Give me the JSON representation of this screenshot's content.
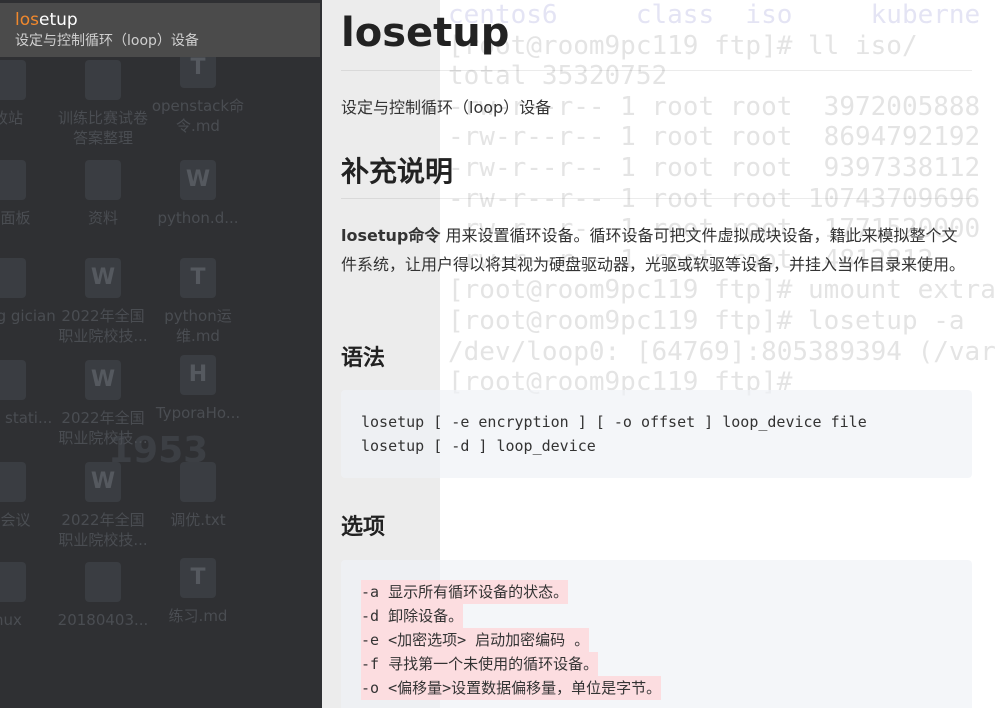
{
  "search_result": {
    "match": "los",
    "rest": "etup",
    "description": "设定与控制循环（loop）设备"
  },
  "desktop": {
    "icons": [
      "收站",
      "训练比赛试卷答案整理",
      "openstack命令.md",
      "制面板",
      "资料",
      "python.d...",
      "nsung gician",
      "2022年全国职业院校技...",
      "python运维.md",
      "ware stati...",
      "2022年全国职业院校技...",
      "TyporaHo...",
      "讯会议",
      "2022年全国职业院校技...",
      "调优.txt",
      "nux",
      "20180403...",
      "练习.md"
    ],
    "wallpaper_year": "1953"
  },
  "terminal": {
    "lines": [
      "centos6     class  iso     kuberne",
      "[root@room9pc119 ftp]# ll iso/",
      "total 35320752",
      "-rw-r--r-- 1 root root  3972005888",
      "-rw-r--r-- 1 root root  8694792192",
      "-rw-r--r-- 1 root root  9397338112",
      "-rw-r--r-- 1 root root 10743709696",
      "-rw-r--r-- 1 root root  1771520000",
      "-rw-r--r-- 1 root root  4812812",
      "[root@room9pc119 ftp]# umount extra",
      "[root@room9pc119 ftp]# losetup -a",
      "/dev/loop0: [64769]:805389394 (/var",
      "[root@room9pc119 ftp]#"
    ]
  },
  "doc": {
    "title": "losetup",
    "subtitle": "设定与控制循环（loop）设备",
    "h_more": "补充说明",
    "desc_bold": "losetup命令",
    "desc": " 用来设置循环设备。循环设备可把文件虚拟成块设备，籍此来模拟整个文件系统，让用户得以将其视为硬盘驱动器，光驱或软驱等设备，并挂入当作目录来使用。",
    "h_syntax": "语法",
    "syntax": [
      "losetup [ -e encryption ] [ -o offset ] loop_device file",
      "losetup [ -d ] loop_device"
    ],
    "h_options": "选项",
    "options": [
      "-a 显示所有循环设备的状态。",
      "-d 卸除设备。",
      "-e <加密选项> 启动加密编码 。",
      "-f 寻找第一个未使用的循环设备。",
      "-o <偏移量>设置数据偏移量，单位是字节。"
    ]
  }
}
